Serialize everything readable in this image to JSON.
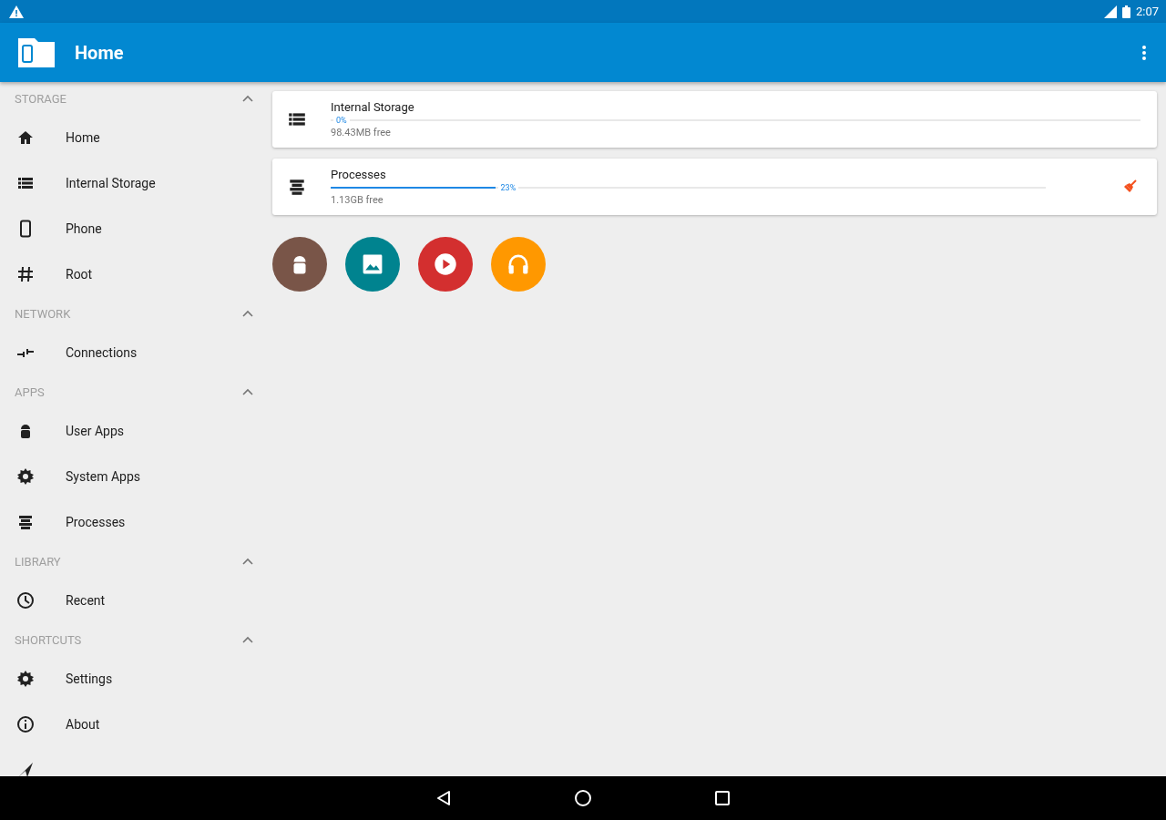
{
  "status_bar": {
    "time": "2:07"
  },
  "app_bar": {
    "title": "Home"
  },
  "sidebar": {
    "sections": [
      {
        "title": "STORAGE",
        "expanded": true,
        "items": [
          {
            "label": "Home",
            "kind": "home"
          },
          {
            "label": "Internal Storage",
            "kind": "list"
          },
          {
            "label": "Phone",
            "kind": "phone"
          },
          {
            "label": "Root",
            "kind": "hash"
          }
        ]
      },
      {
        "title": "NETWORK",
        "expanded": true,
        "items": [
          {
            "label": "Connections",
            "kind": "connections"
          }
        ]
      },
      {
        "title": "APPS",
        "expanded": true,
        "items": [
          {
            "label": "User Apps",
            "kind": "android"
          },
          {
            "label": "System Apps",
            "kind": "gear"
          },
          {
            "label": "Processes",
            "kind": "processes"
          }
        ]
      },
      {
        "title": "LIBRARY",
        "expanded": true,
        "items": [
          {
            "label": "Recent",
            "kind": "clock"
          }
        ]
      },
      {
        "title": "SHORTCUTS",
        "expanded": true,
        "items": [
          {
            "label": "Settings",
            "kind": "gear"
          },
          {
            "label": "About",
            "kind": "info"
          },
          {
            "kind": "share"
          }
        ]
      }
    ]
  },
  "cards": [
    {
      "kind": "list",
      "title": "Internal Storage",
      "level": 0.0,
      "percent": "0%",
      "subtitle": "98.43MB free",
      "clean": false
    },
    {
      "kind": "processes",
      "title": "Processes",
      "level": 0.23,
      "percent": "23%",
      "subtitle": "1.13GB free",
      "clean": true
    }
  ],
  "shortcuts": [
    {
      "kind": "android",
      "color": "#795548"
    },
    {
      "kind": "image",
      "color": "#00838f"
    },
    {
      "kind": "play",
      "color": "#d32f2f"
    },
    {
      "kind": "headphones",
      "color": "#ff9800"
    }
  ]
}
